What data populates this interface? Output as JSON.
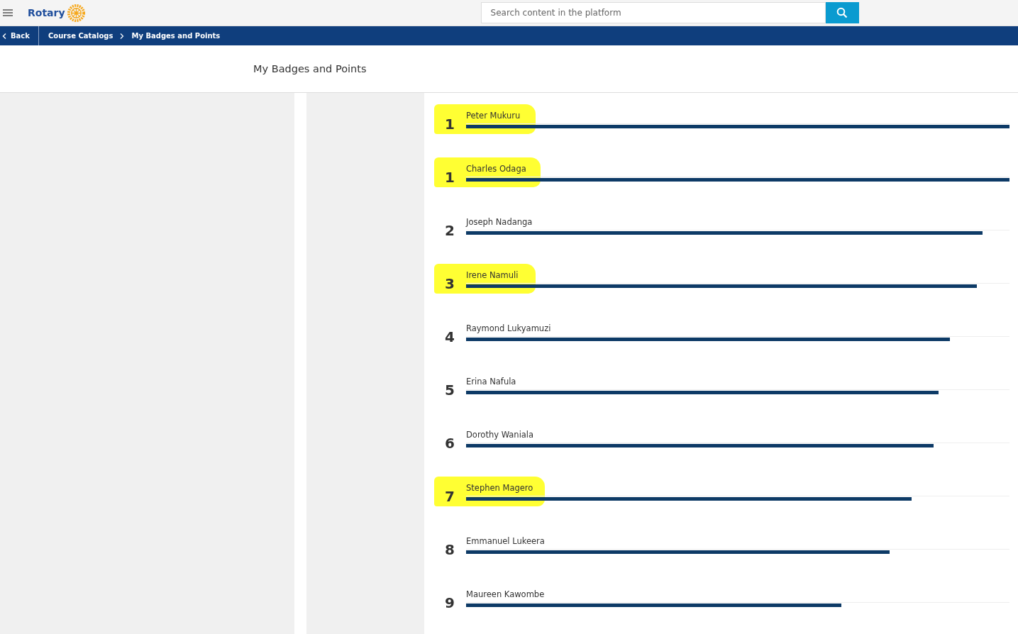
{
  "header": {
    "logo_text": "Rotary",
    "search": {
      "placeholder": "Search content in the platform"
    }
  },
  "breadcrumb": {
    "back": "Back",
    "items": [
      "Course Catalogs",
      "My Badges and Points"
    ]
  },
  "page_title": "My Badges and Points",
  "rows": [
    {
      "rank": "1",
      "name": "Peter Mukuru",
      "level": 1.0,
      "highlighted": true
    },
    {
      "rank": "1",
      "name": "Charles Odaga",
      "level": 1.0,
      "highlighted": true
    },
    {
      "rank": "2",
      "name": "Joseph Nadanga",
      "level": 0.95,
      "highlighted": false
    },
    {
      "rank": "3",
      "name": "Irene Namuli",
      "level": 0.94,
      "highlighted": true
    },
    {
      "rank": "4",
      "name": "Raymond Lukyamuzi",
      "level": 0.89,
      "highlighted": false
    },
    {
      "rank": "5",
      "name": "Erina Nafula",
      "level": 0.87,
      "highlighted": false
    },
    {
      "rank": "6",
      "name": "Dorothy Waniala",
      "level": 0.86,
      "highlighted": false
    },
    {
      "rank": "7",
      "name": "Stephen Magero",
      "level": 0.82,
      "highlighted": true
    },
    {
      "rank": "8",
      "name": "Emmanuel Lukeera",
      "level": 0.78,
      "highlighted": false
    },
    {
      "rank": "9",
      "name": "Maureen Kawombe",
      "level": 0.69,
      "highlighted": false
    }
  ]
}
